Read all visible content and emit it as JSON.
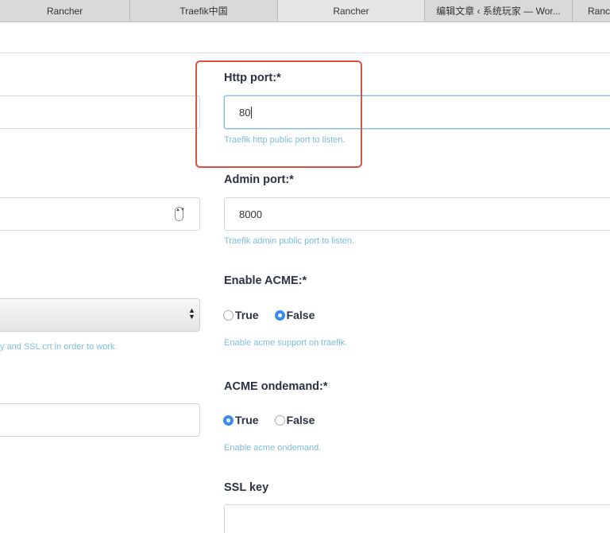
{
  "tabs": [
    {
      "label": "Rancher",
      "active": false
    },
    {
      "label": "Traefik中国",
      "active": false
    },
    {
      "label": "Rancher",
      "active": true
    },
    {
      "label": "编辑文章 ‹ 系统玩家 — Wor...",
      "active": false
    },
    {
      "label": "Ranch",
      "active": false
    }
  ],
  "left": {
    "select_arrows": "▲▼",
    "stepper_arrows": "▲▼",
    "ssl_help_partial": "y and SSL crt in order to work."
  },
  "form": {
    "http_port": {
      "label": "Http port:*",
      "value": "80",
      "help": "Traefik http public port to listen."
    },
    "admin_port": {
      "label": "Admin port:*",
      "value": "8000",
      "help": "Traefik admin public port to listen."
    },
    "enable_acme": {
      "label": "Enable ACME:*",
      "true_label": "True",
      "false_label": "False",
      "selected": "False",
      "help": "Enable acme support on traefik."
    },
    "acme_ondemand": {
      "label": "ACME ondemand:*",
      "true_label": "True",
      "false_label": "False",
      "selected": "True",
      "help": "Enable acme ondemand."
    },
    "ssl_key": {
      "label": "SSL key"
    }
  },
  "colors": {
    "highlight": "#e0513a",
    "radio_selected": "#3b8ded",
    "help_text": "#7fbcd6"
  }
}
